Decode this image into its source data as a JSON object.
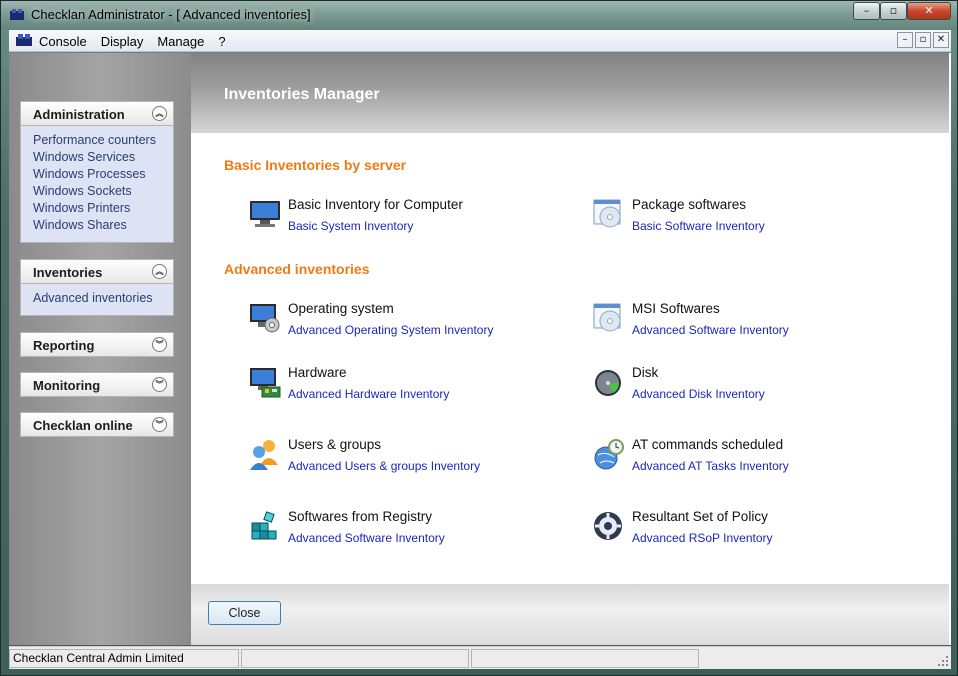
{
  "window": {
    "title": "Checklan Administrator - [ Advanced inventories]"
  },
  "title_controls": {
    "minimize": "–",
    "restore": "▫",
    "close": "✕"
  },
  "menu": {
    "items": [
      "Console",
      "Display",
      "Manage",
      "?"
    ]
  },
  "mdi_controls": {
    "minimize": "–",
    "restore": "▫",
    "close": "✕"
  },
  "sidebar": {
    "panels": [
      {
        "title": "Administration",
        "expanded": true,
        "items": [
          "Performance counters",
          "Windows Services",
          "Windows Processes",
          "Windows Sockets",
          "Windows Printers",
          "Windows Shares"
        ]
      },
      {
        "title": "Inventories",
        "expanded": true,
        "items": [
          "Advanced inventories"
        ]
      },
      {
        "title": "Reporting",
        "expanded": false,
        "items": []
      },
      {
        "title": "Monitoring",
        "expanded": false,
        "items": []
      },
      {
        "title": "Checklan online",
        "expanded": false,
        "items": []
      }
    ],
    "chevron_up": "︽",
    "chevron_down": "︾"
  },
  "main": {
    "title": "Inventories Manager",
    "sections": [
      {
        "title": "Basic Inventories by server",
        "items": [
          {
            "name": "Basic Inventory for  Computer",
            "link": "Basic System Inventory",
            "icon": "computer-icon"
          },
          {
            "name": "Package softwares",
            "link": "Basic Software Inventory",
            "icon": "cd-window-icon"
          }
        ]
      },
      {
        "title": "Advanced inventories",
        "items": [
          {
            "name": "Operating system",
            "link": "Advanced Operating System Inventory",
            "icon": "os-gear-icon"
          },
          {
            "name": "MSI Softwares",
            "link": "Advanced Software Inventory",
            "icon": "cd-window-icon"
          },
          {
            "name": "Hardware",
            "link": "Advanced Hardware Inventory",
            "icon": "hardware-icon"
          },
          {
            "name": "Disk",
            "link": "Advanced Disk Inventory",
            "icon": "disk-icon"
          },
          {
            "name": "Users & groups",
            "link": "Advanced Users & groups Inventory",
            "icon": "users-icon"
          },
          {
            "name": "AT commands scheduled",
            "link": "Advanced AT Tasks Inventory",
            "icon": "clock-globe-icon"
          },
          {
            "name": "Softwares from Registry",
            "link": "Advanced Software Inventory",
            "icon": "registry-icon"
          },
          {
            "name": "Resultant Set of Policy",
            "link": "Advanced RSoP Inventory",
            "icon": "policy-gear-icon"
          }
        ]
      }
    ],
    "close_label": "Close"
  },
  "statusbar": {
    "cells": [
      "Checklan Central Admin Limited",
      "",
      ""
    ]
  },
  "colors": {
    "section_title": "#f07a16",
    "link": "#1c25c2",
    "panel_body": "#dde3f5"
  }
}
